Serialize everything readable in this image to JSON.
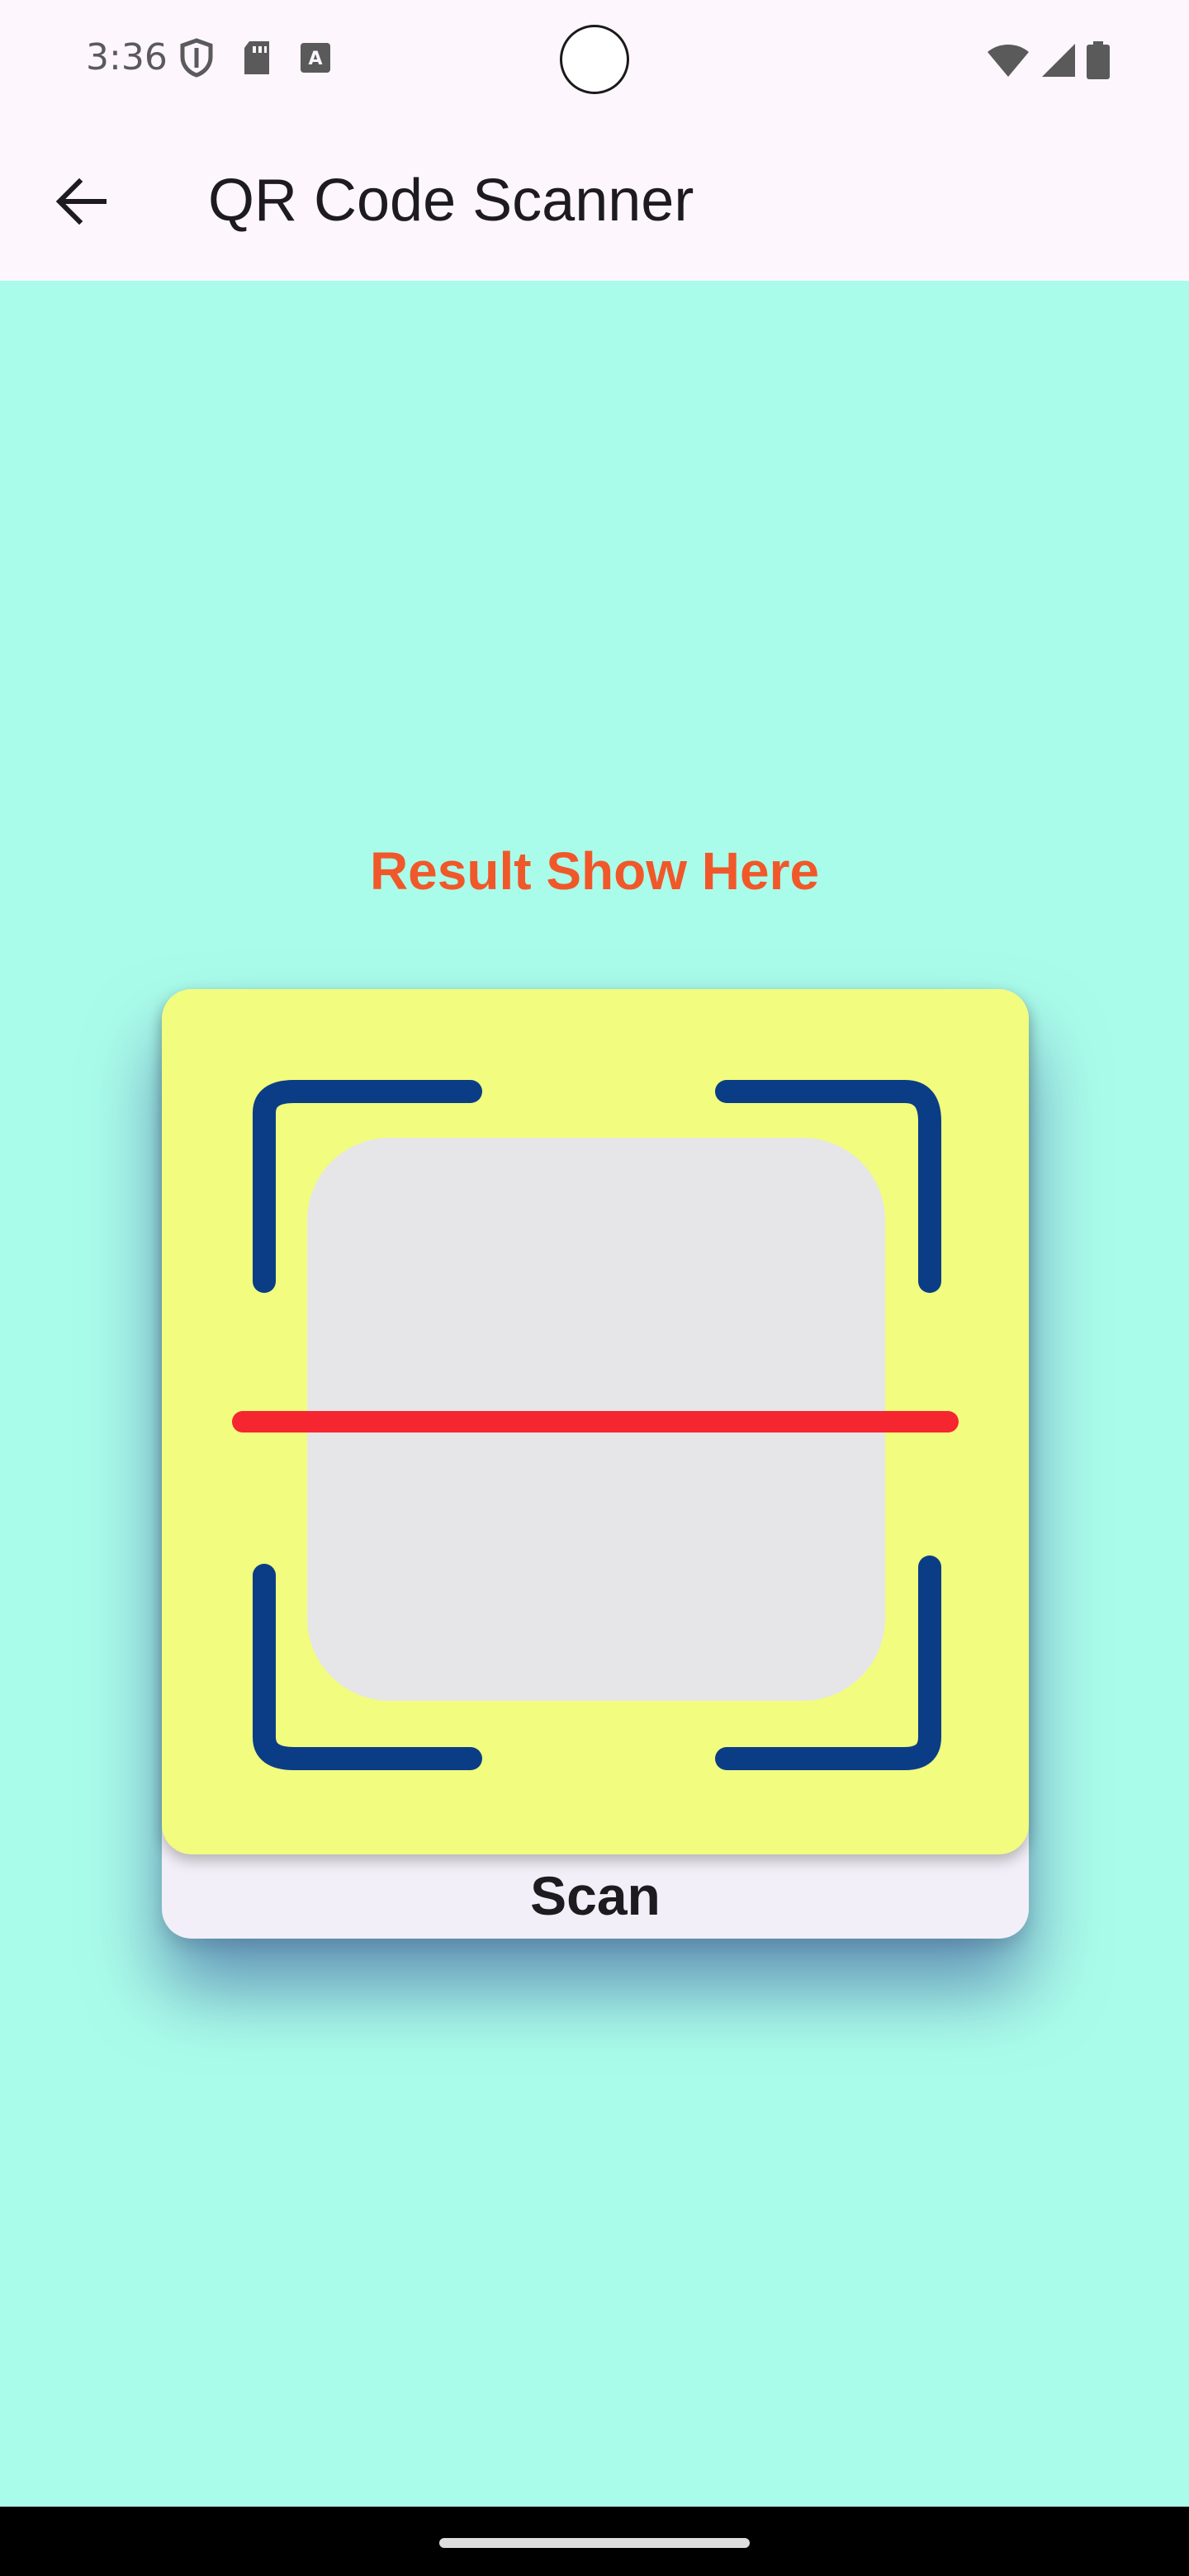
{
  "status_bar": {
    "time": "3:36",
    "left_icons": [
      "shield-icon",
      "sd-card-icon",
      "keyboard-a-icon"
    ],
    "right_icons": [
      "wifi-icon",
      "signal-icon",
      "battery-icon"
    ]
  },
  "app_bar": {
    "title": "QR Code Scanner",
    "back_icon": "arrow-back-icon"
  },
  "main": {
    "result_text": "Result Show Here",
    "scan_button_label": "Scan",
    "scan_image_icon": "qr-scan-frame-icon"
  },
  "colors": {
    "background": "#aafcea",
    "result_text": "#f0582a",
    "scan_image_bg": "#f2fc7e",
    "frame_corners": "#0b3d86",
    "scan_line": "#f5262f",
    "inner_square": "#e6e6e8"
  }
}
